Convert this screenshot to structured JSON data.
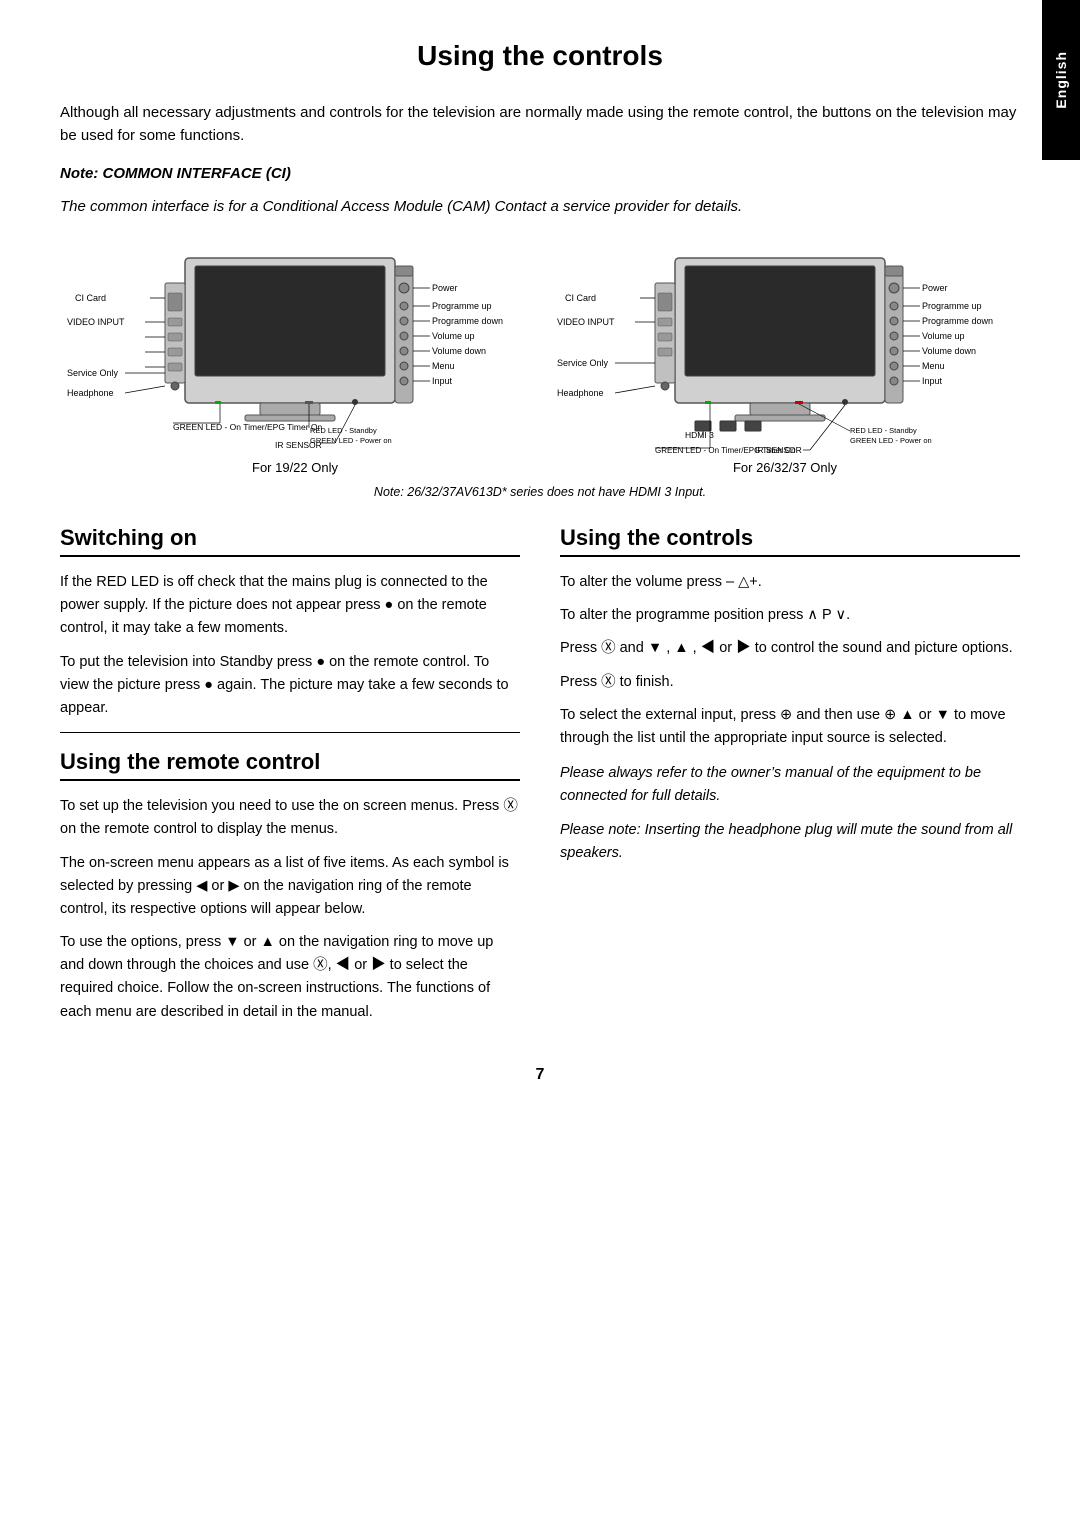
{
  "page": {
    "title": "Using the controls",
    "side_tab": "English",
    "page_number": "7"
  },
  "intro": {
    "main_text": "Although all necessary adjustments and controls for the television are normally made using the remote control, the buttons on the television may be used for some functions.",
    "note_title": "Note: COMMON INTERFACE (CI)",
    "note_text": "The common interface is for a Conditional Access Module (CAM) Contact a service provider for details."
  },
  "diagrams": {
    "left_label": "For 19/22 Only",
    "right_label": "For 26/32/37 Only",
    "note": "Note: 26/32/37AV613D* series does not have HDMI 3 Input.",
    "left_labels": [
      "Power",
      "Programme up",
      "Programme down",
      "Volume up",
      "Volume down",
      "Menu",
      "Input",
      "CI Card",
      "VIDEO INPUT",
      "Service Only",
      "Headphone",
      "GREEN LED - On Timer/EPG Timer On",
      "IR SENSOR",
      "RED LED - Standby / GREEN LED - Power on"
    ],
    "right_labels": [
      "Power",
      "Programme up",
      "Programme down",
      "Volume up",
      "Volume down",
      "Menu",
      "Input",
      "CI Card",
      "VIDEO INPUT",
      "Service Only",
      "Headphone",
      "HDMI 3",
      "IR SENSOR",
      "RED LED - Standby / GREEN LED - Power on",
      "GREEN LED - On Timer/EPG Timer On"
    ]
  },
  "sections": {
    "switching_on": {
      "title": "Switching on",
      "paragraphs": [
        "If the RED LED is off check that the mains plug is connected to the power supply. If the picture does not appear press ℹ on the remote control, it may take a few moments.",
        "To put the television into Standby press ℹ on the remote control. To view the picture press ℹ again. The picture may take a few seconds to appear."
      ]
    },
    "remote_control": {
      "title": "Using the remote control",
      "paragraphs": [
        "To set up the television you need to use the on screen menus. Press Ⓜ on the remote control to display the menus.",
        "The on-screen menu appears as a list of five items. As each symbol is selected by pressing ◄ or ► on the navigation ring of the remote control, its respective options will appear below.",
        "To use the options, press ▼ or ▲ on the navigation ring to move up and down through the choices and use Ⓜ, ◄ or ► to select the required choice. Follow the on-screen instructions. The functions of each menu are described in detail in the manual."
      ]
    },
    "using_controls": {
      "title": "Using the controls",
      "paragraphs": [
        "To alter the volume press – △+.",
        "To alter the programme position press ∧ P ∨.",
        "Press Ⓜ and ▼ , ▲ , ◄ or ► to control the sound and picture options.",
        "Press Ⓜ to finish.",
        "To select the external input, press Ⓢ and then use Ⓢ ▲ or ▼ to move through the list until the appropriate input source is selected."
      ],
      "italic_paragraphs": [
        "Please always refer to the owner’s manual of the equipment to be connected for full details.",
        "Please note: Inserting the headphone plug will mute the sound from all speakers."
      ]
    }
  }
}
